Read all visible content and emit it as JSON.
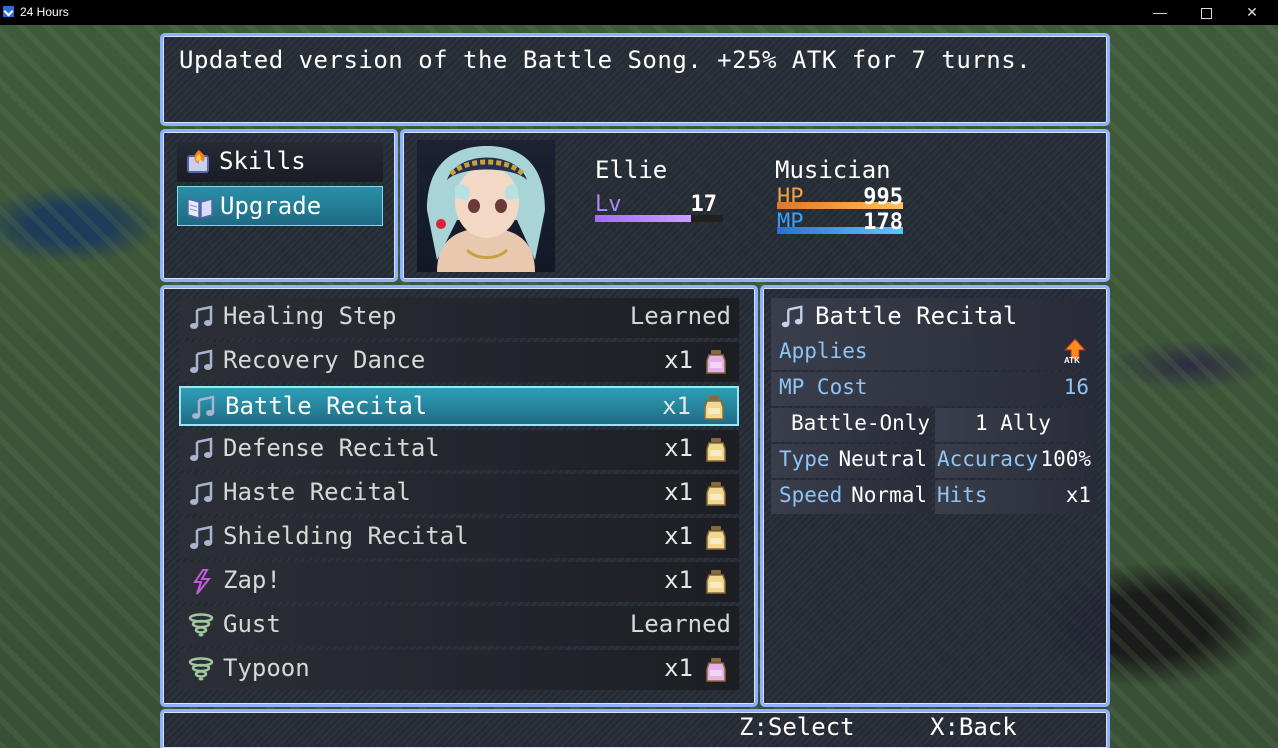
{
  "window": {
    "title": "24 Hours",
    "minimize": "—",
    "close": "✕"
  },
  "help": {
    "text": "Updated version of the Battle Song. +25% ATK for 7 turns."
  },
  "commands": [
    {
      "label": "Skills",
      "icon": "fire-book-icon"
    },
    {
      "label": "Upgrade",
      "icon": "open-book-icon",
      "selected": true
    }
  ],
  "actor": {
    "name": "Ellie",
    "class": "Musician",
    "level_label": "Lv",
    "level": "17",
    "hp_label": "HP",
    "hp": "995",
    "mp_label": "MP",
    "mp": "178",
    "hp_fraction": 1.0,
    "mp_fraction": 1.0,
    "level_fraction": 0.75
  },
  "skills": [
    {
      "name": "Healing Step",
      "status": "Learned",
      "icon": "music-note-icon"
    },
    {
      "name": "Recovery Dance",
      "cost": "x1",
      "icon": "music-note-icon",
      "jar": "pink"
    },
    {
      "name": "Battle Recital",
      "cost": "x1",
      "icon": "music-note-icon",
      "jar": "yellow",
      "selected": true
    },
    {
      "name": "Defense Recital",
      "cost": "x1",
      "icon": "music-note-icon",
      "jar": "yellow"
    },
    {
      "name": "Haste Recital",
      "cost": "x1",
      "icon": "music-note-icon",
      "jar": "yellow"
    },
    {
      "name": "Shielding Recital",
      "cost": "x1",
      "icon": "music-note-icon",
      "jar": "yellow"
    },
    {
      "name": "Zap!",
      "cost": "x1",
      "icon": "lightning-icon",
      "jar": "yellow"
    },
    {
      "name": "Gust",
      "status": "Learned",
      "icon": "tornado-icon"
    },
    {
      "name": "Typoon",
      "cost": "x1",
      "icon": "tornado-icon",
      "jar": "pink"
    }
  ],
  "detail": {
    "name": "Battle Recital",
    "applies_label": "Applies",
    "applies_badge": "ATK",
    "mp_cost_label": "MP Cost",
    "mp_cost": "16",
    "occasion": "Battle-Only",
    "scope": "1 Ally",
    "type_label": "Type",
    "type": "Neutral",
    "accuracy_label": "Accuracy",
    "accuracy": "100%",
    "speed_label": "Speed",
    "speed": "Normal",
    "hits_label": "Hits",
    "hits": "x1"
  },
  "hints": {
    "select": "Z:Select",
    "back": "X:Back"
  },
  "colors": {
    "window_border": "#8fb0ff",
    "selection": "#2a8fa8",
    "hp": "#f2a23a",
    "mp": "#3a9ff2",
    "label_blue": "#8fc4f4"
  }
}
